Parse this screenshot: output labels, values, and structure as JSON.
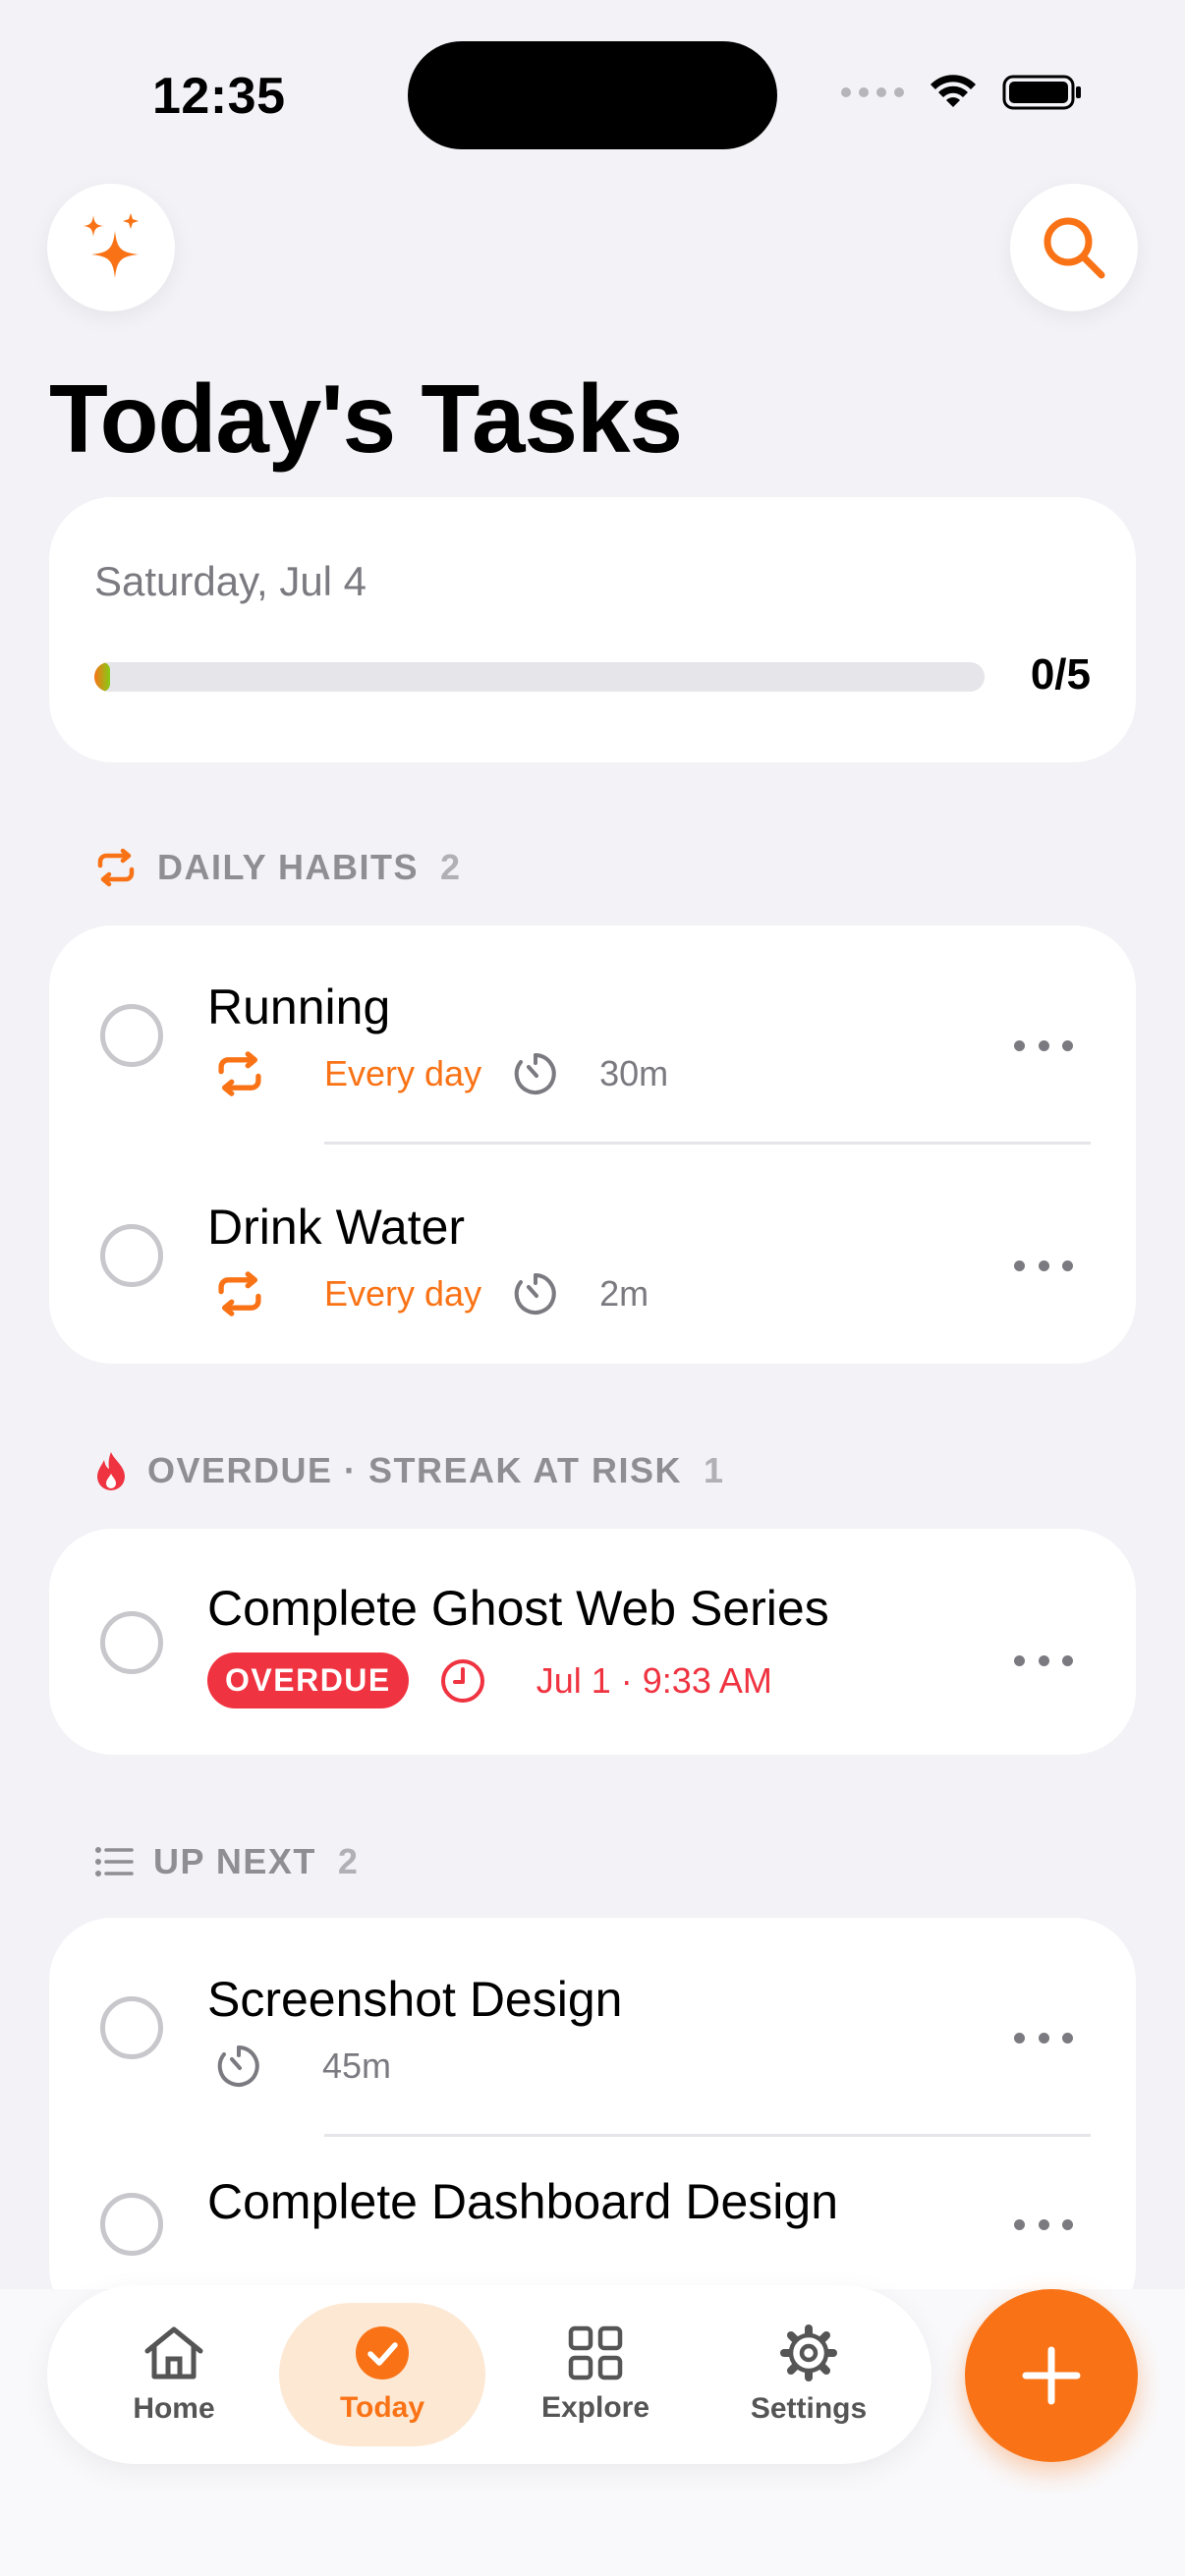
{
  "status_bar": {
    "time": "12:35"
  },
  "header": {
    "title": "Today's Tasks"
  },
  "progress": {
    "date": "Saturday, Jul 4",
    "count_text": "0/5",
    "completed_fraction": 0.0
  },
  "sections": {
    "daily_habits": {
      "label": "DAILY HABITS",
      "count": "2",
      "tasks": [
        {
          "title": "Running",
          "repeat": "Every day",
          "duration": "30m"
        },
        {
          "title": "Drink Water",
          "repeat": "Every day",
          "duration": "2m"
        }
      ]
    },
    "overdue": {
      "label": "OVERDUE · STREAK AT RISK",
      "count": "1",
      "tasks": [
        {
          "title": "Complete Ghost Web Series",
          "badge": "OVERDUE",
          "due": "Jul 1 · 9:33 AM"
        }
      ]
    },
    "up_next": {
      "label": "UP NEXT",
      "count": "2",
      "tasks": [
        {
          "title": "Screenshot Design",
          "duration": "45m"
        },
        {
          "title": "Complete Dashboard Design"
        }
      ]
    }
  },
  "tab_bar": {
    "items": [
      {
        "label": "Home",
        "icon": "house-icon"
      },
      {
        "label": "Today",
        "icon": "check-circle-icon",
        "active": true
      },
      {
        "label": "Explore",
        "icon": "grid-icon"
      },
      {
        "label": "Settings",
        "icon": "gear-icon"
      }
    ]
  },
  "colors": {
    "accent": "#F97316",
    "danger": "#EF3340",
    "background": "#F2F2F7"
  }
}
